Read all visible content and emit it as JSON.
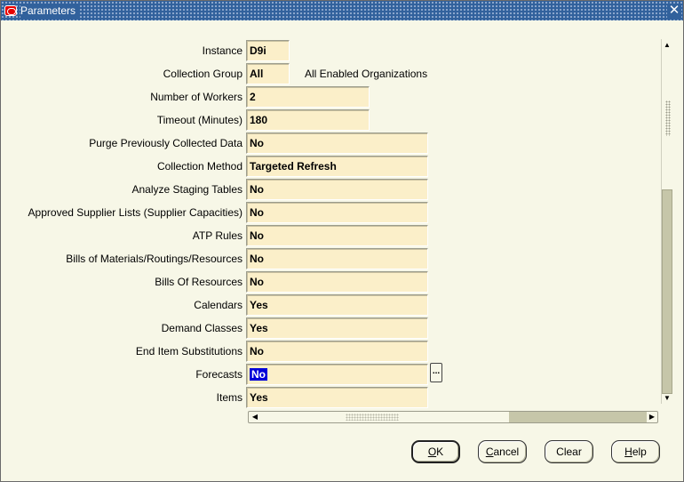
{
  "window": {
    "title": "Parameters",
    "close_symbol": "✕"
  },
  "parameters": [
    {
      "label": "Instance",
      "value": "D9i"
    },
    {
      "label": "Collection Group",
      "value": "All",
      "description": "All Enabled Organizations"
    },
    {
      "label": "Number of Workers",
      "value": "2"
    },
    {
      "label": "Timeout (Minutes)",
      "value": "180"
    },
    {
      "label": "Purge Previously Collected Data",
      "value": "No"
    },
    {
      "label": "Collection Method",
      "value": "Targeted Refresh"
    },
    {
      "label": "Analyze Staging Tables",
      "value": "No"
    },
    {
      "label": "Approved Supplier Lists (Supplier Capacities)",
      "value": "No"
    },
    {
      "label": "ATP Rules",
      "value": "No"
    },
    {
      "label": "Bills of Materials/Routings/Resources",
      "value": "No"
    },
    {
      "label": "Bills Of Resources",
      "value": "No"
    },
    {
      "label": "Calendars",
      "value": "Yes"
    },
    {
      "label": "Demand Classes",
      "value": "Yes"
    },
    {
      "label": "End Item Substitutions",
      "value": "No"
    },
    {
      "label": "Forecasts",
      "value": "No",
      "selected": true
    },
    {
      "label": "Items",
      "value": "Yes"
    }
  ],
  "lov_button_label": "...",
  "buttons": {
    "ok": {
      "mnemonic": "O",
      "rest": "K"
    },
    "cancel": {
      "mnemonic": "C",
      "rest": "ancel"
    },
    "clear": {
      "label": "Clear"
    },
    "help": {
      "mnemonic": "H",
      "rest": "elp"
    }
  },
  "icons": {
    "app_icon": "oracle-logo-icon",
    "close": "close-icon",
    "scroll_up": "arrow-up-icon",
    "scroll_down": "arrow-down-icon",
    "scroll_left": "arrow-left-icon",
    "scroll_right": "arrow-right-icon"
  },
  "colors": {
    "titlebar": "#31619c",
    "field_background": "#fbefc9",
    "window_background": "#f7f7e7",
    "selection": "#0000d8"
  }
}
